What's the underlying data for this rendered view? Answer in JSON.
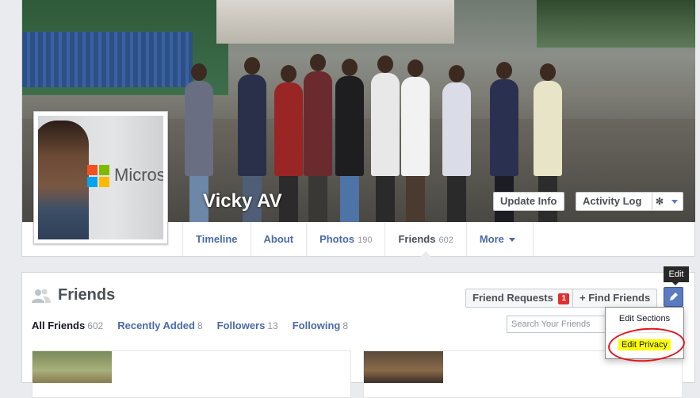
{
  "profile": {
    "name": "Vicky AV",
    "profile_pic_text": "Micros"
  },
  "header_buttons": {
    "update_info": "Update Info",
    "activity_log": "Activity Log",
    "settings_icon": "gear-icon"
  },
  "tabs": [
    {
      "label": "Timeline",
      "count": ""
    },
    {
      "label": "About",
      "count": ""
    },
    {
      "label": "Photos",
      "count": "190"
    },
    {
      "label": "Friends",
      "count": "602"
    },
    {
      "label": "More",
      "count": ""
    }
  ],
  "friends": {
    "title": "Friends",
    "friend_requests_label": "Friend Requests",
    "friend_requests_badge": "1",
    "find_friends_label": "+ Find Friends",
    "search_placeholder": "Search Your Friends",
    "subtabs": [
      {
        "label": "All Friends",
        "count": "602"
      },
      {
        "label": "Recently Added",
        "count": "8"
      },
      {
        "label": "Followers",
        "count": "13"
      },
      {
        "label": "Following",
        "count": "8"
      }
    ]
  },
  "edit_menu": {
    "tooltip": "Edit",
    "items": [
      "Edit Sections",
      "Edit Privacy"
    ]
  },
  "colors": {
    "link": "#4b6aa8",
    "badge": "#e02f2f",
    "highlight": "#ffff00",
    "annotation": "#e1141c"
  }
}
